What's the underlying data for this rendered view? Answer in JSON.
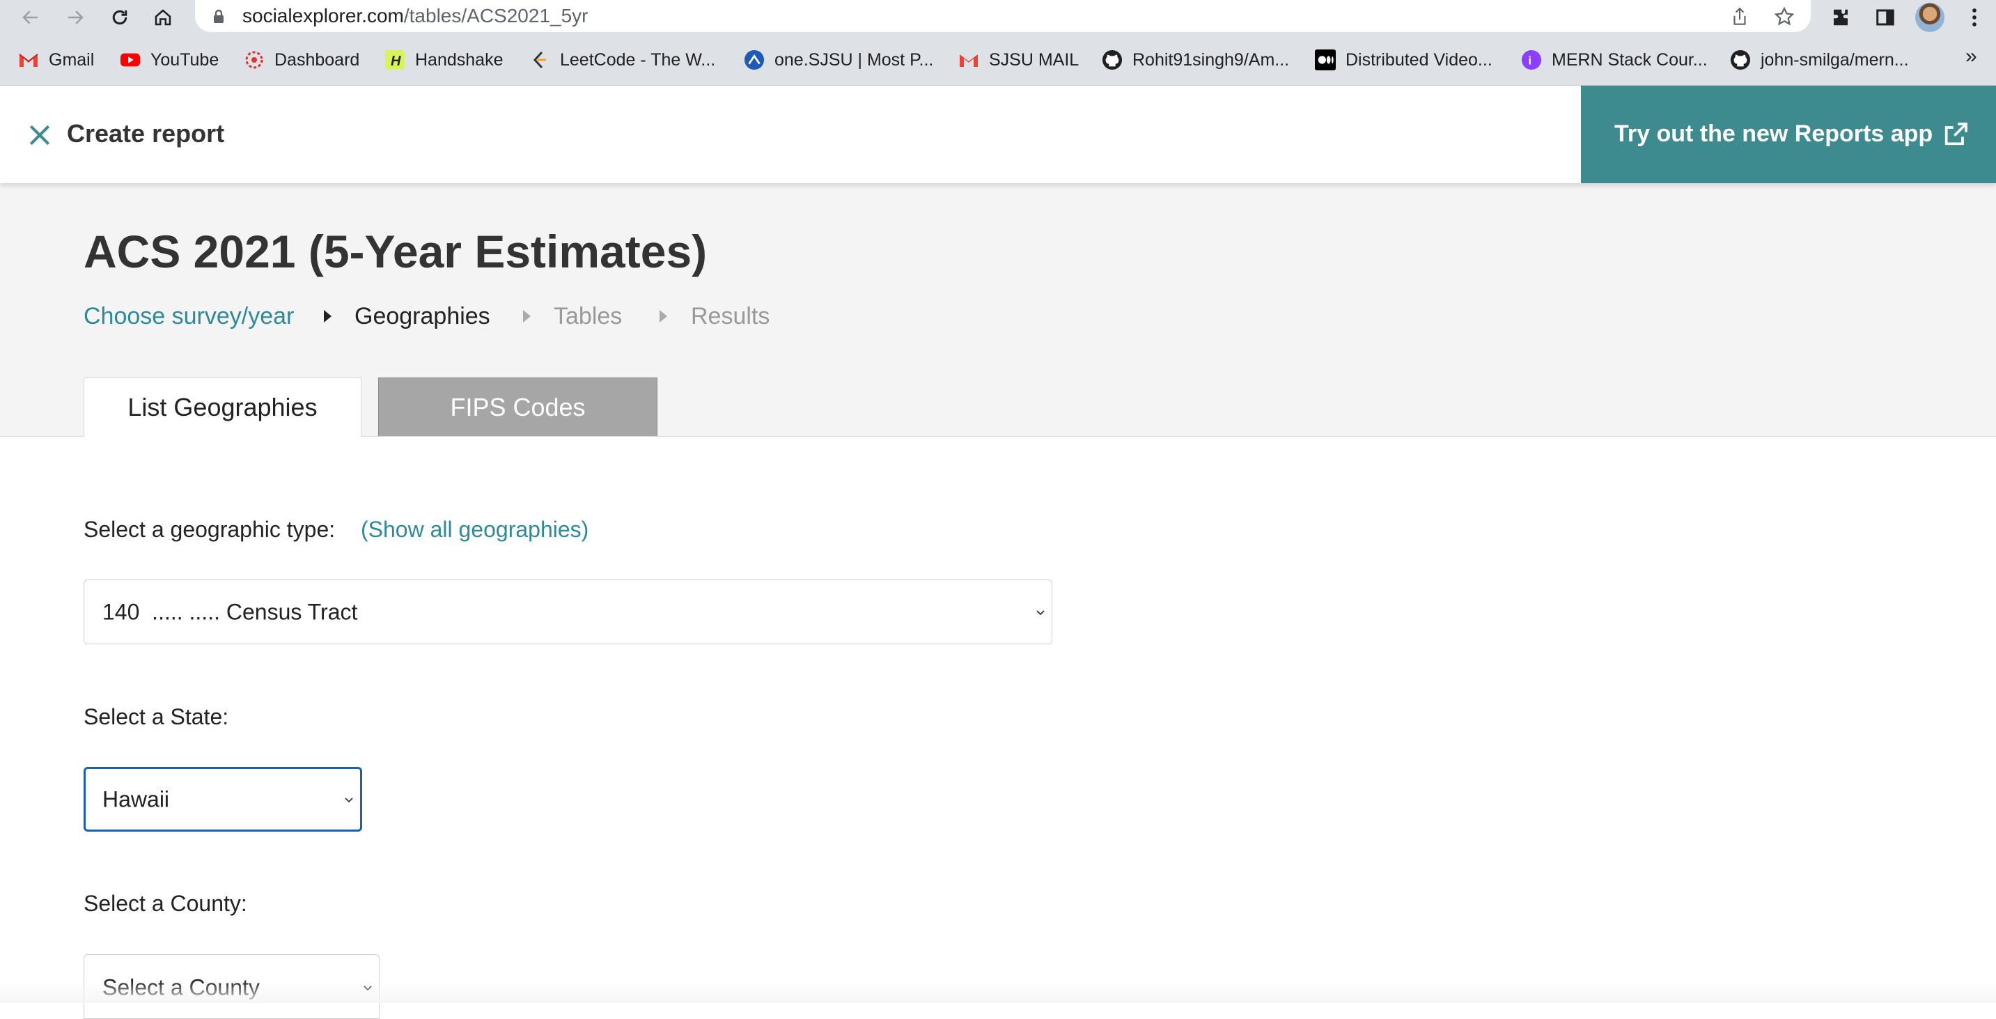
{
  "browser": {
    "url_host": "socialexplorer.com",
    "url_path": "/tables/ACS2021_5yr",
    "bookmarks": [
      {
        "label": "Gmail",
        "icon": "gmail-icon"
      },
      {
        "label": "YouTube",
        "icon": "youtube-icon"
      },
      {
        "label": "Dashboard",
        "icon": "dashboard-icon"
      },
      {
        "label": "Handshake",
        "icon": "handshake-icon"
      },
      {
        "label": "LeetCode - The W...",
        "icon": "leetcode-icon"
      },
      {
        "label": "one.SJSU | Most P...",
        "icon": "sjsu-icon"
      },
      {
        "label": "SJSU MAIL",
        "icon": "gmail-icon"
      },
      {
        "label": "Rohit91singh9/Am...",
        "icon": "github-icon"
      },
      {
        "label": "Distributed Video...",
        "icon": "medium-icon"
      },
      {
        "label": "MERN Stack Cour...",
        "icon": "course-icon"
      },
      {
        "label": "john-smilga/mern...",
        "icon": "github-icon"
      }
    ],
    "more_label": "»"
  },
  "header": {
    "title": "Create report",
    "try_new_label": "Try out the new Reports app",
    "accent_color": "#3d8a8f"
  },
  "page": {
    "title": "ACS 2021 (5-Year Estimates)",
    "breadcrumb": {
      "step1": "Choose survey/year",
      "step2": "Geographies",
      "step3": "Tables",
      "step4": "Results"
    },
    "tabs": {
      "list": "List Geographies",
      "fips": "FIPS Codes"
    }
  },
  "form": {
    "geo_type_label": "Select a geographic type:",
    "show_all_link": "(Show all geographies)",
    "geo_type_value": "140  ..... ..... Census Tract",
    "state_label": "Select a State:",
    "state_value": "Hawaii",
    "county_label": "Select a County:",
    "county_value": "Select a County"
  }
}
